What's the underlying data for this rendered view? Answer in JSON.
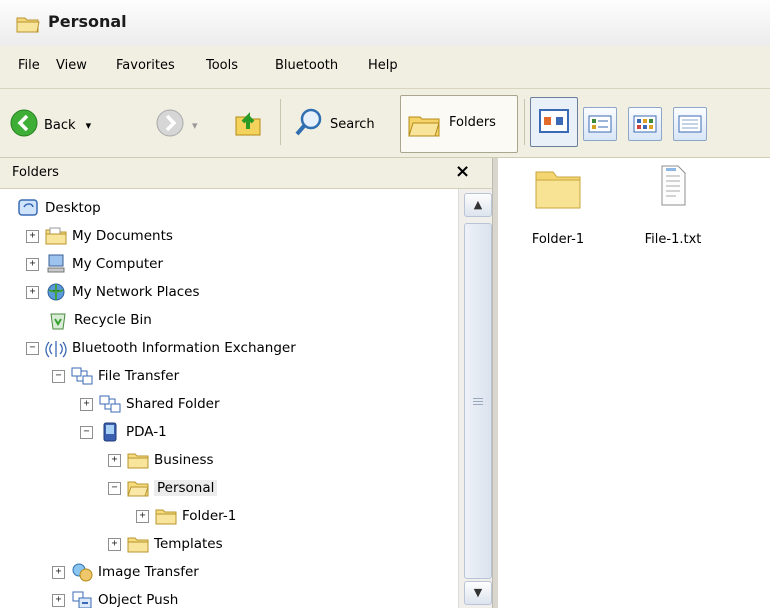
{
  "window": {
    "title": "Personal"
  },
  "menu": {
    "items": [
      {
        "label": "File"
      },
      {
        "label": "View"
      },
      {
        "label": "Favorites"
      },
      {
        "label": "Tools"
      },
      {
        "label": "Bluetooth"
      },
      {
        "label": "Help"
      }
    ]
  },
  "toolbar": {
    "back_label": "Back",
    "search_label": "Search",
    "folders_label": "Folders",
    "dropdown_glyph": "▾"
  },
  "folder_pane": {
    "title": "Folders",
    "close_glyph": "×",
    "tree": [
      {
        "label": "Desktop",
        "icon": "desktop-icon",
        "expander": ""
      },
      {
        "label": "My Documents",
        "icon": "folder-icon",
        "expander": "+"
      },
      {
        "label": "My Computer",
        "icon": "computer-icon",
        "expander": "+"
      },
      {
        "label": "My Network Places",
        "icon": "network-icon",
        "expander": "+"
      },
      {
        "label": "Recycle Bin",
        "icon": "recycle-bin-icon",
        "expander": ""
      },
      {
        "label": "Bluetooth Information Exchanger",
        "icon": "bluetooth-icon",
        "expander": "−"
      },
      {
        "label": "File Transfer",
        "icon": "file-transfer-icon",
        "expander": "−"
      },
      {
        "label": "Shared Folder",
        "icon": "file-transfer-icon",
        "expander": "+"
      },
      {
        "label": "PDA-1",
        "icon": "pda-icon",
        "expander": "−"
      },
      {
        "label": "Business",
        "icon": "folder-icon",
        "expander": "+"
      },
      {
        "label": "Personal",
        "icon": "open-folder-icon",
        "expander": "−",
        "selected": true
      },
      {
        "label": "Folder-1",
        "icon": "folder-icon",
        "expander": "+"
      },
      {
        "label": "Templates",
        "icon": "folder-icon",
        "expander": "+"
      },
      {
        "label": "Image Transfer",
        "icon": "image-transfer-icon",
        "expander": "+"
      },
      {
        "label": "Object Push",
        "icon": "object-push-icon",
        "expander": "+"
      }
    ]
  },
  "content": {
    "items": [
      {
        "label": "Folder-1",
        "icon": "folder-icon"
      },
      {
        "label": "File-1.txt",
        "icon": "text-file-icon"
      }
    ]
  },
  "scrollbar": {
    "up_glyph": "▲",
    "down_glyph": "▼"
  }
}
